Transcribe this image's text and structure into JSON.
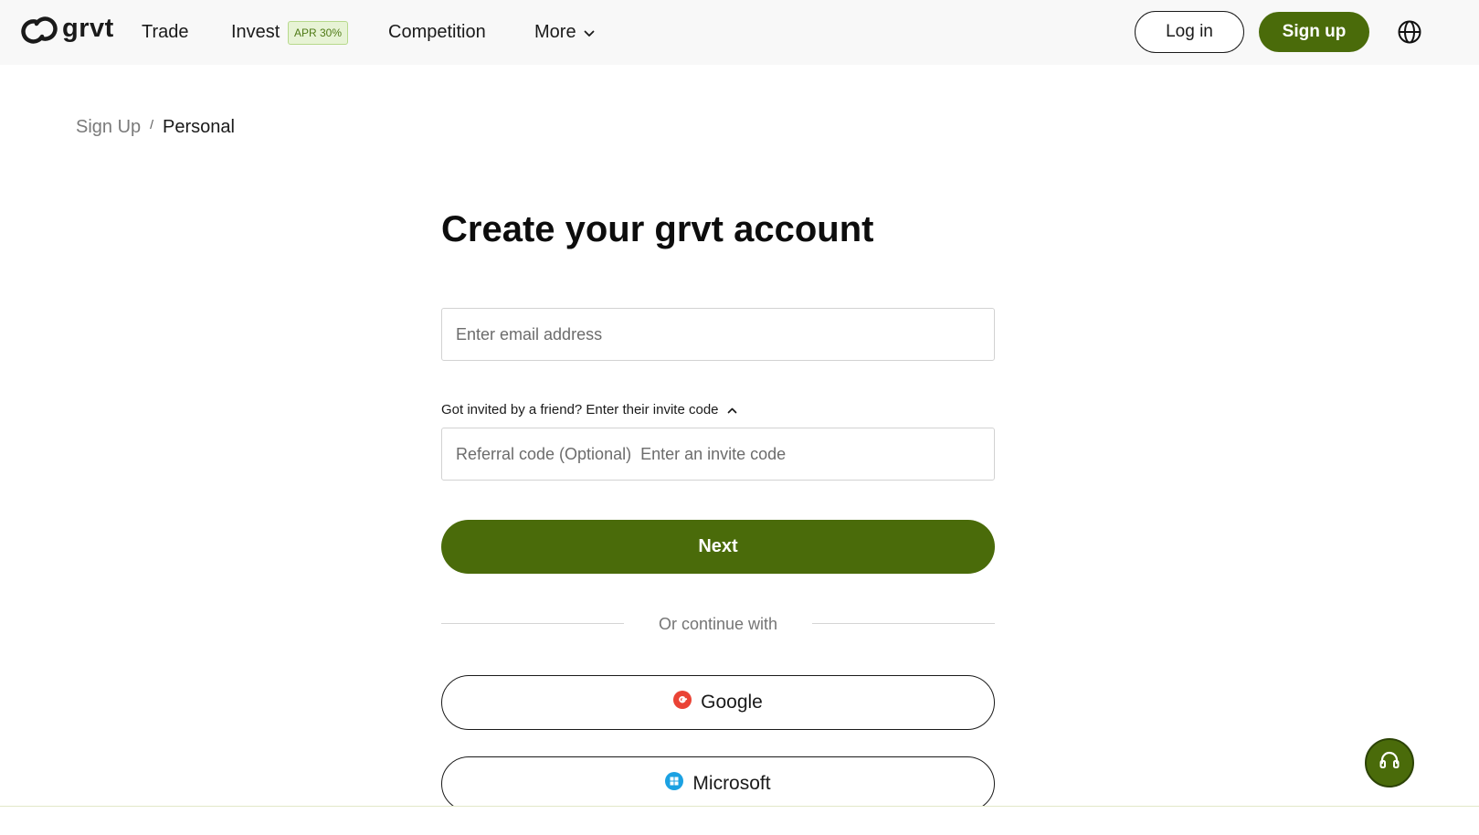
{
  "brand": {
    "name": "grvt"
  },
  "nav": {
    "trade": "Trade",
    "invest": "Invest",
    "invest_badge": "APR 30%",
    "competition": "Competition",
    "more": "More",
    "login": "Log in",
    "signup": "Sign up",
    "language_icon": "globe-icon"
  },
  "breadcrumb": {
    "parent": "Sign Up",
    "separator": "/",
    "current": "Personal"
  },
  "form": {
    "title": "Create your grvt account",
    "email_placeholder": "Enter email address",
    "email_value": "",
    "invite_toggle": "Got invited by a friend? Enter their invite code",
    "referral_label": "Referral code (Optional)",
    "referral_placeholder": "Enter an invite code",
    "referral_value": "",
    "next": "Next",
    "divider": "Or continue with",
    "google": "Google",
    "microsoft": "Microsoft"
  },
  "colors": {
    "accent": "#4a6b0a",
    "badge_bg": "#e7f3d5",
    "badge_text": "#4f7a16",
    "google_red": "#ea4335",
    "microsoft_blue": "#1ba1e2"
  },
  "support": {
    "icon": "headset-icon"
  }
}
